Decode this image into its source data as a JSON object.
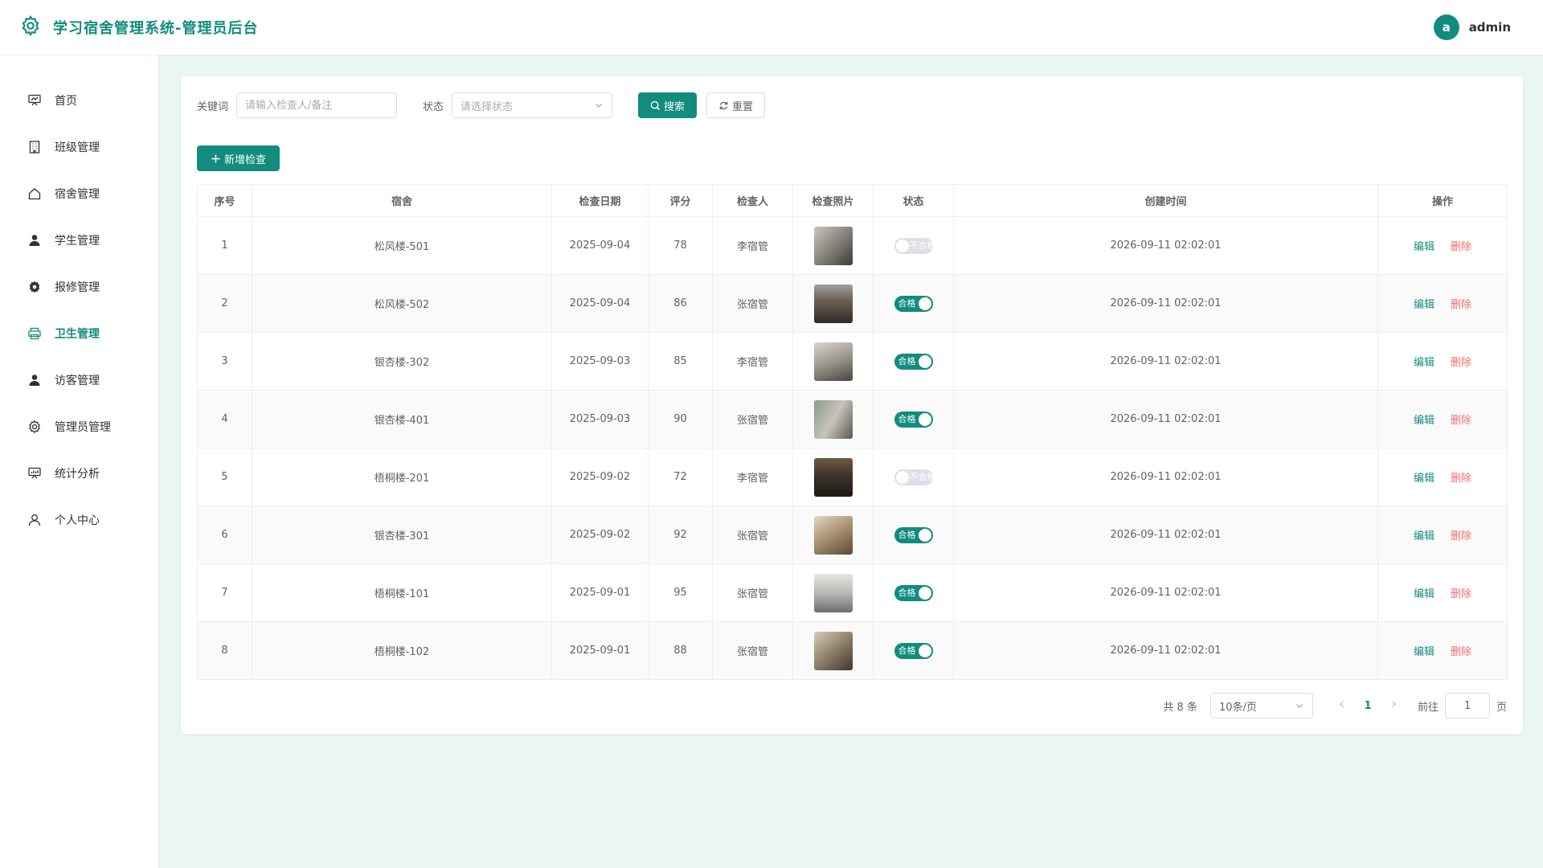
{
  "header": {
    "title": "学习宿舍管理系统-管理员后台",
    "avatar_letter": "a",
    "username": "admin"
  },
  "colors": {
    "accent": "#128c7e",
    "danger": "#f56c6c"
  },
  "sidebar": {
    "items": [
      {
        "label": "首页",
        "icon": "dashboard-icon"
      },
      {
        "label": "班级管理",
        "icon": "building-icon"
      },
      {
        "label": "宿舍管理",
        "icon": "home-icon"
      },
      {
        "label": "学生管理",
        "icon": "user-icon"
      },
      {
        "label": "报修管理",
        "icon": "gear-icon"
      },
      {
        "label": "卫生管理",
        "icon": "printer-icon",
        "active": true
      },
      {
        "label": "访客管理",
        "icon": "user-icon"
      },
      {
        "label": "管理员管理",
        "icon": "settings-icon"
      },
      {
        "label": "统计分析",
        "icon": "chart-icon"
      },
      {
        "label": "个人中心",
        "icon": "profile-icon"
      }
    ]
  },
  "filters": {
    "keyword_label": "关键词",
    "keyword_placeholder": "请输入检查人/备注",
    "status_label": "状态",
    "status_placeholder": "请选择状态",
    "search_label": "搜索",
    "reset_label": "重置"
  },
  "add_button": "新增检查",
  "table": {
    "columns": [
      "序号",
      "宿舍",
      "检查日期",
      "评分",
      "检查人",
      "检查照片",
      "状态",
      "创建时间",
      "操作"
    ],
    "rows": [
      {
        "no": "1",
        "dorm": "松风楼-501",
        "date": "2025-09-04",
        "score": "78",
        "inspector": "李宿管",
        "passed": false,
        "created": "2026-09-11 02:02:01"
      },
      {
        "no": "2",
        "dorm": "松风楼-502",
        "date": "2025-09-04",
        "score": "86",
        "inspector": "张宿管",
        "passed": true,
        "created": "2026-09-11 02:02:01"
      },
      {
        "no": "3",
        "dorm": "银杏楼-302",
        "date": "2025-09-03",
        "score": "85",
        "inspector": "李宿管",
        "passed": true,
        "created": "2026-09-11 02:02:01"
      },
      {
        "no": "4",
        "dorm": "银杏楼-401",
        "date": "2025-09-03",
        "score": "90",
        "inspector": "张宿管",
        "passed": true,
        "created": "2026-09-11 02:02:01"
      },
      {
        "no": "5",
        "dorm": "梧桐楼-201",
        "date": "2025-09-02",
        "score": "72",
        "inspector": "李宿管",
        "passed": false,
        "created": "2026-09-11 02:02:01"
      },
      {
        "no": "6",
        "dorm": "银杏楼-301",
        "date": "2025-09-02",
        "score": "92",
        "inspector": "张宿管",
        "passed": true,
        "created": "2026-09-11 02:02:01"
      },
      {
        "no": "7",
        "dorm": "梧桐楼-101",
        "date": "2025-09-01",
        "score": "95",
        "inspector": "张宿管",
        "passed": true,
        "created": "2026-09-11 02:02:01"
      },
      {
        "no": "8",
        "dorm": "梧桐楼-102",
        "date": "2025-09-01",
        "score": "88",
        "inspector": "张宿管",
        "passed": true,
        "created": "2026-09-11 02:02:01"
      }
    ],
    "pass_label": "合格",
    "fail_label": "不合格",
    "edit_label": "编辑",
    "delete_label": "删除"
  },
  "pagination": {
    "total": "共 8 条",
    "page_size": "10条/页",
    "current": "1",
    "goto_label": "前往",
    "goto_value": "1",
    "page_unit": "页"
  }
}
